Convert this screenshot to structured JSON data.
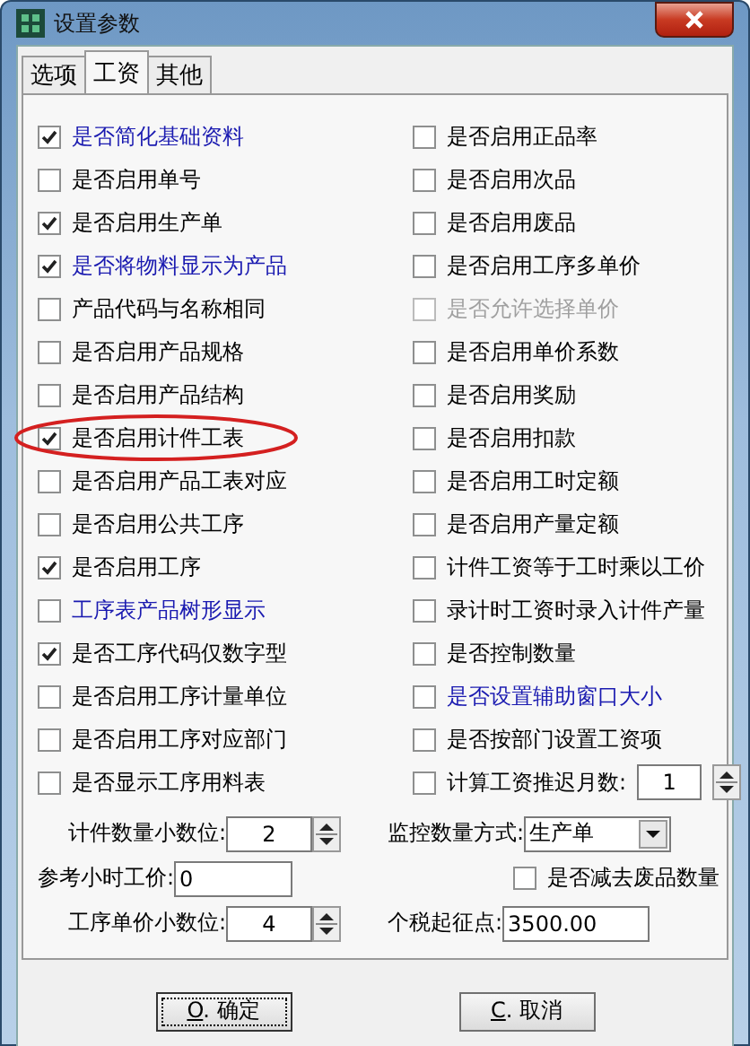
{
  "window": {
    "title": "设置参数"
  },
  "tabs": [
    {
      "label": "选项",
      "selected": false
    },
    {
      "label": "工资",
      "selected": true
    },
    {
      "label": "其他",
      "selected": false
    }
  ],
  "left_options": [
    {
      "kind": "checkbox",
      "label": "是否简化基础资料",
      "checked": true,
      "disabled": false,
      "color": "#1a1ab0",
      "circled": false
    },
    {
      "kind": "checkbox",
      "label": "是否启用单号",
      "checked": false,
      "disabled": false,
      "color": "#000000",
      "circled": false
    },
    {
      "kind": "checkbox",
      "label": "是否启用生产单",
      "checked": true,
      "disabled": false,
      "color": "#000000",
      "circled": false
    },
    {
      "kind": "checkbox",
      "label": "是否将物料显示为产品",
      "checked": true,
      "disabled": false,
      "color": "#1a1ab0",
      "circled": false
    },
    {
      "kind": "checkbox",
      "label": "产品代码与名称相同",
      "checked": false,
      "disabled": false,
      "color": "#000000",
      "circled": false
    },
    {
      "kind": "checkbox",
      "label": "是否启用产品规格",
      "checked": false,
      "disabled": false,
      "color": "#000000",
      "circled": false
    },
    {
      "kind": "checkbox",
      "label": "是否启用产品结构",
      "checked": false,
      "disabled": false,
      "color": "#000000",
      "circled": false
    },
    {
      "kind": "checkbox",
      "label": "是否启用计件工表",
      "checked": true,
      "disabled": false,
      "color": "#000000",
      "circled": true
    },
    {
      "kind": "checkbox",
      "label": "是否启用产品工表对应",
      "checked": false,
      "disabled": false,
      "color": "#000000",
      "circled": false
    },
    {
      "kind": "checkbox",
      "label": "是否启用公共工序",
      "checked": false,
      "disabled": false,
      "color": "#000000",
      "circled": false
    },
    {
      "kind": "checkbox",
      "label": "是否启用工序",
      "checked": true,
      "disabled": false,
      "color": "#000000",
      "circled": false
    },
    {
      "kind": "checkbox",
      "label": "工序表产品树形显示",
      "checked": false,
      "disabled": false,
      "color": "#1a1ab0",
      "circled": false
    },
    {
      "kind": "checkbox",
      "label": "是否工序代码仅数字型",
      "checked": true,
      "disabled": false,
      "color": "#000000",
      "circled": false
    },
    {
      "kind": "checkbox",
      "label": "是否启用工序计量单位",
      "checked": false,
      "disabled": false,
      "color": "#000000",
      "circled": false
    },
    {
      "kind": "checkbox",
      "label": "是否启用工序对应部门",
      "checked": false,
      "disabled": false,
      "color": "#000000",
      "circled": false
    },
    {
      "kind": "checkbox",
      "label": "是否显示工序用料表",
      "checked": false,
      "disabled": false,
      "color": "#000000",
      "circled": false
    }
  ],
  "right_options": [
    {
      "kind": "checkbox",
      "label": "是否启用正品率",
      "checked": false,
      "disabled": false,
      "color": "#000000",
      "circled": false
    },
    {
      "kind": "checkbox",
      "label": "是否启用次品",
      "checked": false,
      "disabled": false,
      "color": "#000000",
      "circled": false
    },
    {
      "kind": "checkbox",
      "label": "是否启用废品",
      "checked": false,
      "disabled": false,
      "color": "#000000",
      "circled": false
    },
    {
      "kind": "checkbox",
      "label": "是否启用工序多单价",
      "checked": false,
      "disabled": false,
      "color": "#000000",
      "circled": false
    },
    {
      "kind": "checkbox",
      "label": "是否允许选择单价",
      "checked": false,
      "disabled": true,
      "circled": false
    },
    {
      "kind": "checkbox",
      "label": "是否启用单价系数",
      "checked": false,
      "disabled": false,
      "color": "#000000",
      "circled": false
    },
    {
      "kind": "checkbox",
      "label": "是否启用奖励",
      "checked": false,
      "disabled": false,
      "color": "#000000",
      "circled": false
    },
    {
      "kind": "checkbox",
      "label": "是否启用扣款",
      "checked": false,
      "disabled": false,
      "color": "#000000",
      "circled": false
    },
    {
      "kind": "checkbox",
      "label": "是否启用工时定额",
      "checked": false,
      "disabled": false,
      "color": "#000000",
      "circled": false
    },
    {
      "kind": "checkbox",
      "label": "是否启用产量定额",
      "checked": false,
      "disabled": false,
      "color": "#000000",
      "circled": false
    },
    {
      "kind": "checkbox",
      "label": "计件工资等于工时乘以工价",
      "checked": false,
      "disabled": false,
      "color": "#000000",
      "circled": false
    },
    {
      "kind": "checkbox",
      "label": "录计时工资时录入计件产量",
      "checked": false,
      "disabled": false,
      "color": "#000000",
      "circled": false
    },
    {
      "kind": "checkbox",
      "label": "是否控制数量",
      "checked": false,
      "disabled": false,
      "color": "#000000",
      "circled": false
    },
    {
      "kind": "checkbox",
      "label": "是否设置辅助窗口大小",
      "checked": false,
      "disabled": false,
      "color": "#1a1ab0",
      "circled": false
    },
    {
      "kind": "checkbox",
      "label": "是否按部门设置工资项",
      "checked": false,
      "disabled": false,
      "color": "#000000",
      "circled": false
    },
    {
      "kind": "checkbox-spinner",
      "label": "计算工资推迟月数:",
      "checked": false,
      "disabled": false,
      "color": "#000000",
      "circled": false,
      "value": "1"
    }
  ],
  "left_fields": [
    {
      "kind": "spinner",
      "label": "计件数量小数位:",
      "value": "2"
    },
    {
      "kind": "text",
      "label": "参考小时工价:",
      "value": "0"
    },
    {
      "kind": "spinner",
      "label": "工序单价小数位:",
      "value": "4"
    }
  ],
  "right_fields": [
    {
      "kind": "dropdown",
      "label": "监控数量方式:",
      "value": "生产单"
    },
    {
      "kind": "checkbox",
      "label": "是否减去废品数量",
      "checked": false
    },
    {
      "kind": "text",
      "label": "个税起征点:",
      "value": "3500.00"
    }
  ],
  "buttons": [
    {
      "accel": "O",
      "label": ". 确定",
      "focused": true
    },
    {
      "accel": "C",
      "label": ". 取消",
      "focused": false
    }
  ]
}
